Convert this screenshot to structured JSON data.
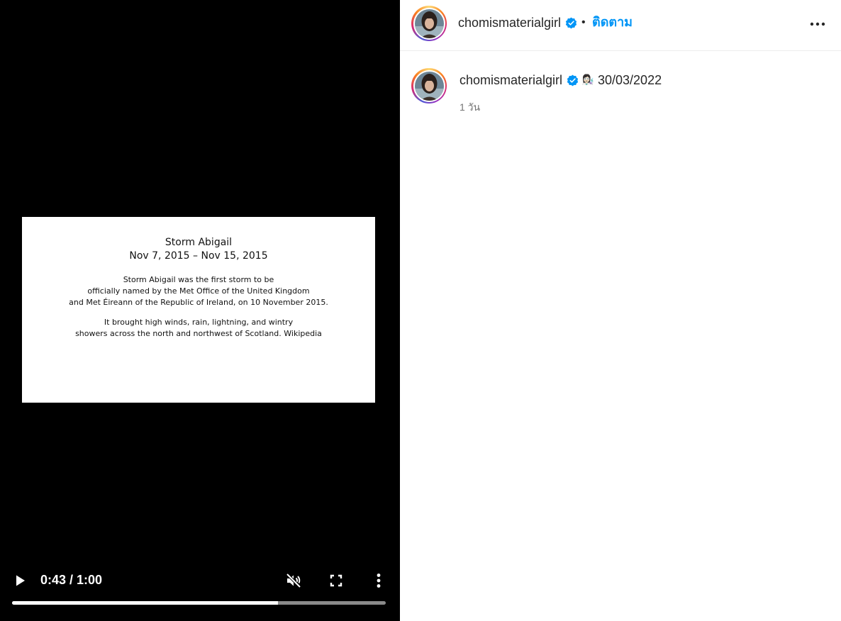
{
  "video": {
    "slide": {
      "title": "Storm Abigail",
      "dates": "Nov 7, 2015 – Nov 15, 2015",
      "paragraph1": [
        "Storm Abigail was the first storm to be",
        "officially named by the Met Office of the United Kingdom",
        "and Met Éireann of the Republic of Ireland, on 10 November 2015."
      ],
      "paragraph2": [
        "It brought high winds, rain, lightning, and wintry",
        "showers across the north and northwest of Scotland. Wikipedia"
      ]
    },
    "controls": {
      "time_display": "0:43 / 1:00",
      "progress_fraction": 0.711,
      "icons": {
        "play": "play-icon",
        "mute": "muted-speaker-icon",
        "fullscreen": "fullscreen-icon",
        "more": "vertical-dots-icon"
      }
    }
  },
  "post": {
    "header": {
      "username": "chomismaterialgirl",
      "verified": true,
      "separator": "•",
      "follow_label": "ติดตาม"
    },
    "caption": {
      "username": "chomismaterialgirl",
      "verified": true,
      "emoji": "👩🏻‍🔬",
      "text": "30/03/2022",
      "age": "1 วัน"
    }
  },
  "colors": {
    "video_background": "#000000",
    "follow_blue": "#0095f6",
    "verified_blue": "#0095f6",
    "progress_played": "#ffffff",
    "progress_remaining": "#8a8a8a"
  }
}
